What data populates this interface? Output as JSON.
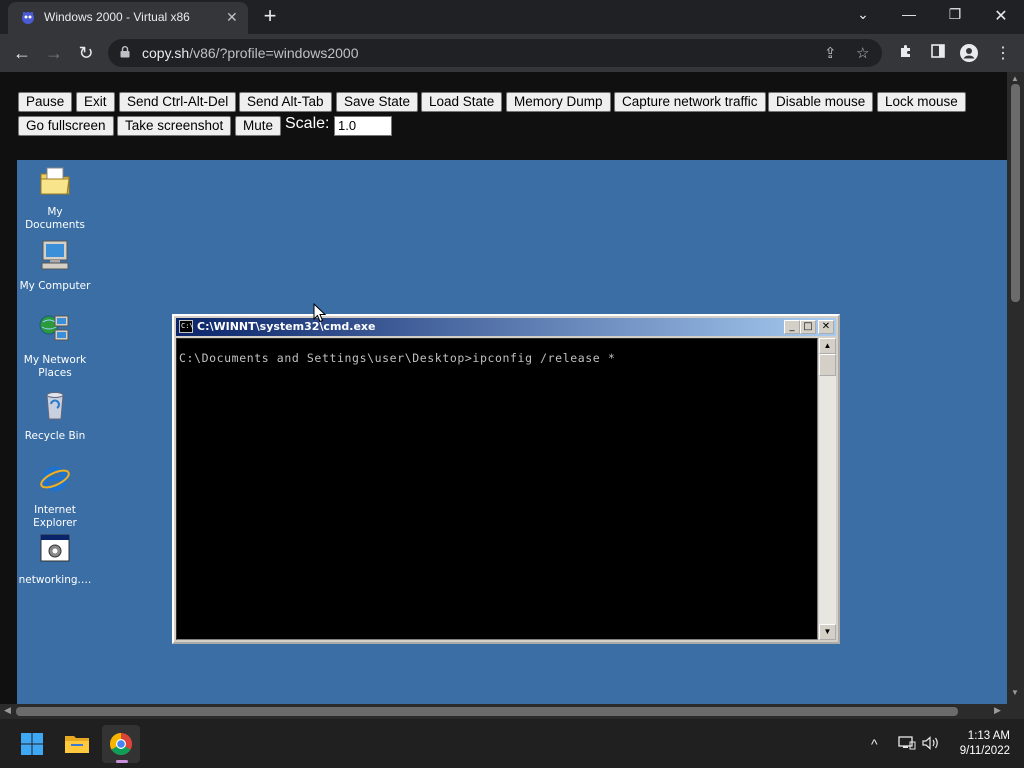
{
  "browser": {
    "tab_title": "Windows 2000 - Virtual x86",
    "tab_close": "✕",
    "new_tab": "+",
    "url_host": "copy.sh",
    "url_path": "/v86/?profile=windows2000",
    "nav": {
      "back": "←",
      "forward": "→",
      "reload": "↻"
    },
    "window_controls": {
      "search": "⌄",
      "minimize": "—",
      "maximize": "❐",
      "close": "✕"
    },
    "icons": [
      "favicon-icon",
      "lock-icon",
      "share-icon",
      "star-icon",
      "extensions-icon",
      "side-panel-icon",
      "profile-icon",
      "menu-icon"
    ]
  },
  "emulator_controls": {
    "row1": [
      "Pause",
      "Exit",
      "Send Ctrl-Alt-Del",
      "Send Alt-Tab",
      "Save State",
      "Load State",
      "Memory Dump",
      "Capture network traffic",
      "Disable mouse",
      "Lock mouse"
    ],
    "row2": [
      "Go fullscreen",
      "Take screenshot",
      "Mute"
    ],
    "scale_label": "Scale:",
    "scale_value": "1.0"
  },
  "desktop": {
    "background_color": "#3a6ea5",
    "icons": [
      {
        "label": "My Documents",
        "icon": "folder-icon"
      },
      {
        "label": "My Computer",
        "icon": "computer-icon"
      },
      {
        "label": "My Network Places",
        "icon": "network-icon"
      },
      {
        "label": "Recycle Bin",
        "icon": "recycle-bin-icon"
      },
      {
        "label": "Internet Explorer",
        "icon": "internet-explorer-icon"
      },
      {
        "label": "networking.…",
        "icon": "program-icon"
      }
    ]
  },
  "cmd_window": {
    "title": "C:\\WINNT\\system32\\cmd.exe",
    "icon_text": "C:\\",
    "buttons": {
      "minimize": "_",
      "maximize": "□",
      "close": "✕"
    },
    "console_line": "C:\\Documents and Settings\\user\\Desktop>ipconfig /release *"
  },
  "taskbar": {
    "apps": [
      "start-icon",
      "file-explorer-icon",
      "chrome-icon"
    ],
    "tray_chevron": "^",
    "time": "1:13 AM",
    "date": "9/11/2022"
  }
}
